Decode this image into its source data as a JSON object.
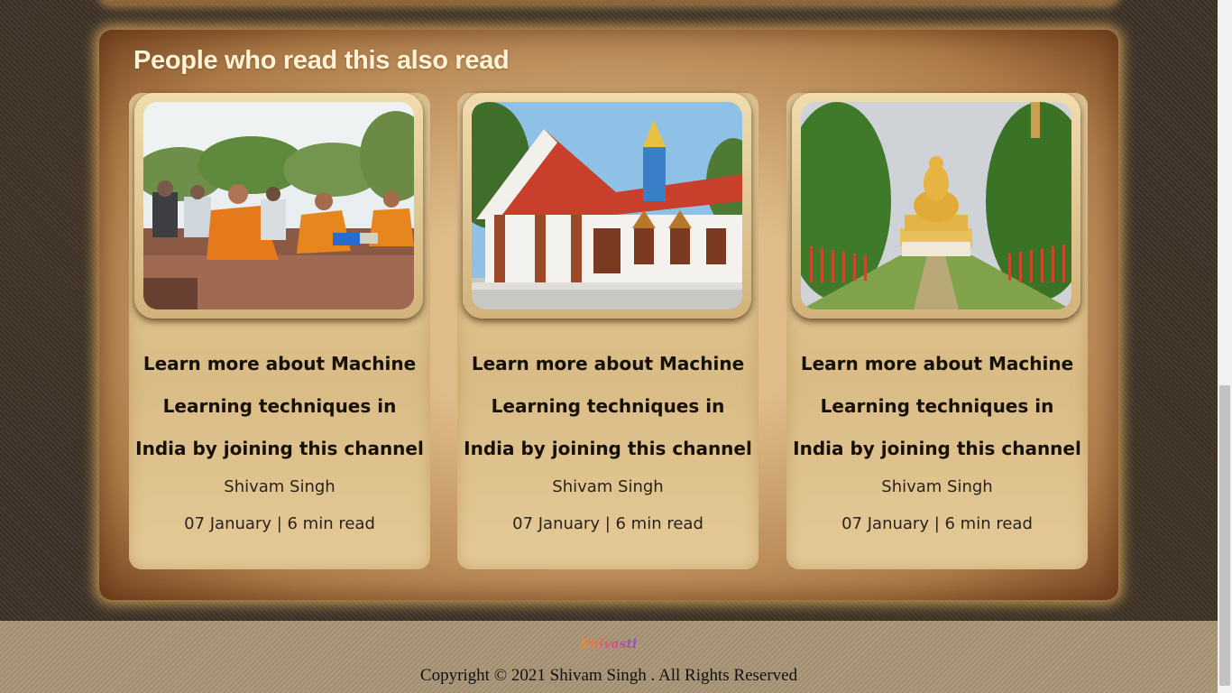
{
  "section": {
    "title": "People who read this also read"
  },
  "cards": [
    {
      "title_lines": [
        "Learn more about Machine",
        "Learning techniques in",
        "India by joining this channel"
      ],
      "author": "Shivam Singh",
      "meta": "07 January | 6 min read",
      "image": "monks-meditating-image"
    },
    {
      "title_lines": [
        "Learn more about Machine",
        "Learning techniques in",
        "India by joining this channel"
      ],
      "author": "Shivam Singh",
      "meta": "07 January | 6 min read",
      "image": "thai-temple-image"
    },
    {
      "title_lines": [
        "Learn more about Machine",
        "Learning techniques in",
        "India by joining this channel"
      ],
      "author": "Shivam Singh",
      "meta": "07 January | 6 min read",
      "image": "golden-buddha-statue-image"
    }
  ],
  "footer": {
    "logo_text": "Shivasti",
    "copyright": "Copyright © 2021 Shivam Singh . All Rights Reserved"
  },
  "colors": {
    "section_title": "#fff3d8",
    "card_text": "#151008",
    "glow": "#e8af5f"
  }
}
